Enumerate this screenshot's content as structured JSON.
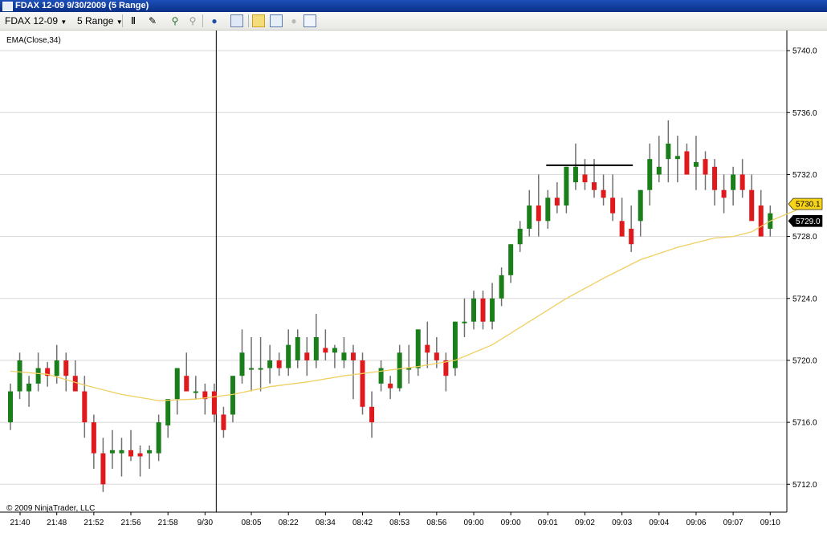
{
  "window": {
    "title": "FDAX 12-09  9/30/2009 (5 Range)"
  },
  "toolbar": {
    "instrument": "FDAX 12-09",
    "period": "5 Range",
    "icons": [
      "bar-type-icon",
      "drawing-pen-icon",
      "zoom-in-icon",
      "zoom-out-icon",
      "globe-icon",
      "properties-icon",
      "strategy-icon",
      "indicator-icon",
      "record-icon",
      "data-box-icon"
    ]
  },
  "chart_data": {
    "type": "candlestick",
    "indicator_label": "EMA(Close,34)",
    "copyright": "© 2009 NinjaTrader, LLC",
    "ylim": [
      5710.2,
      5741.3
    ],
    "yticks": [
      5712.0,
      5716.0,
      5720.0,
      5724.0,
      5728.0,
      5732.0,
      5736.0,
      5740.0
    ],
    "ytick_labels": [
      "5712.0",
      "5716.0",
      "5720.0",
      "5724.0",
      "5728.0",
      "5732.0",
      "5736.0",
      "5740.0"
    ],
    "grid": true,
    "bar_count": 78,
    "xtick_labels": [
      {
        "i": 0,
        "label": "21:40"
      },
      {
        "i": 5,
        "label": "21:48"
      },
      {
        "i": 9,
        "label": "21:52"
      },
      {
        "i": 13,
        "label": "21:56"
      },
      {
        "i": 17,
        "label": "21:58"
      },
      {
        "i": 21,
        "label": "9/30"
      },
      {
        "i": 26,
        "label": "08:05"
      },
      {
        "i": 30,
        "label": "08:22"
      },
      {
        "i": 34,
        "label": "08:34"
      },
      {
        "i": 38,
        "label": "08:42"
      },
      {
        "i": 42,
        "label": "08:53"
      },
      {
        "i": 46,
        "label": "08:56"
      },
      {
        "i": 50,
        "label": "09:00"
      },
      {
        "i": 54,
        "label": "09:00"
      },
      {
        "i": 58,
        "label": "09:01"
      },
      {
        "i": 62,
        "label": "09:02"
      },
      {
        "i": 66,
        "label": "09:03"
      },
      {
        "i": 70,
        "label": "09:04"
      },
      {
        "i": 74,
        "label": "09:06"
      },
      {
        "i": 78,
        "label": "09:07"
      },
      {
        "i": 82,
        "label": "09:10"
      }
    ],
    "session_break_index": 21,
    "candles": [
      [
        0,
        5716.0,
        5718.5,
        5715.5,
        5718.0
      ],
      [
        1,
        5718.0,
        5720.5,
        5717.5,
        5720.0
      ],
      [
        2,
        5718.0,
        5719.0,
        5717.0,
        5718.5
      ],
      [
        3,
        5718.5,
        5720.5,
        5718.0,
        5719.5
      ],
      [
        4,
        5719.5,
        5719.9,
        5718.3,
        5719.0
      ],
      [
        5,
        5719.0,
        5721.0,
        5718.5,
        5720.0
      ],
      [
        6,
        5720.0,
        5720.5,
        5718.0,
        5719.0
      ],
      [
        7,
        5719.0,
        5720.0,
        5718.0,
        5718.0
      ],
      [
        8,
        5718.0,
        5719.0,
        5715.0,
        5716.0
      ],
      [
        9,
        5716.0,
        5716.5,
        5713.0,
        5714.0
      ],
      [
        10,
        5714.0,
        5715.0,
        5711.5,
        5712.0
      ],
      [
        11,
        5714.0,
        5715.5,
        5713.0,
        5714.2
      ],
      [
        12,
        5714.0,
        5715.0,
        5712.5,
        5714.2
      ],
      [
        13,
        5714.2,
        5715.5,
        5713.5,
        5713.8
      ],
      [
        14,
        5714.0,
        5714.5,
        5712.5,
        5713.8
      ],
      [
        15,
        5714.0,
        5714.5,
        5713.0,
        5714.2
      ],
      [
        16,
        5714.0,
        5716.5,
        5713.5,
        5716.0
      ],
      [
        17,
        5715.8,
        5717.0,
        5715.0,
        5717.5
      ],
      [
        18,
        5717.5,
        5719.5,
        5716.5,
        5719.5
      ],
      [
        19,
        5719.0,
        5720.5,
        5718.5,
        5718.0
      ],
      [
        20,
        5718.0,
        5719.0,
        5717.5,
        5718.0
      ],
      [
        21,
        5718.0,
        5718.5,
        5716.5,
        5717.5
      ],
      [
        22,
        5718.0,
        5718.5,
        5716.0,
        5716.5
      ],
      [
        23,
        5716.5,
        5717.0,
        5715.0,
        5715.5
      ],
      [
        24,
        5716.5,
        5719.0,
        5716.0,
        5719.0
      ],
      [
        25,
        5719.0,
        5722.0,
        5718.5,
        5720.5
      ],
      [
        26,
        5719.5,
        5721.5,
        5718.0,
        5719.5
      ],
      [
        27,
        5719.5,
        5721.5,
        5718.0,
        5719.5
      ],
      [
        28,
        5719.5,
        5721.0,
        5718.5,
        5720.0
      ],
      [
        29,
        5720.0,
        5720.5,
        5719.0,
        5719.5
      ],
      [
        30,
        5719.5,
        5722.0,
        5719.0,
        5721.0
      ],
      [
        31,
        5720.0,
        5722.0,
        5719.5,
        5721.5
      ],
      [
        32,
        5720.5,
        5721.5,
        5719.0,
        5720.0
      ],
      [
        33,
        5720.0,
        5723.0,
        5719.5,
        5721.5
      ],
      [
        34,
        5720.8,
        5722.0,
        5720.0,
        5720.5
      ],
      [
        35,
        5720.5,
        5721.0,
        5719.5,
        5720.8
      ],
      [
        36,
        5720.0,
        5721.5,
        5719.5,
        5720.5
      ],
      [
        37,
        5720.5,
        5721.0,
        5717.5,
        5720.0
      ],
      [
        38,
        5720.0,
        5720.5,
        5716.5,
        5717.0
      ],
      [
        39,
        5717.0,
        5718.0,
        5715.0,
        5716.0
      ],
      [
        40,
        5718.5,
        5720.0,
        5718.0,
        5719.5
      ],
      [
        41,
        5718.5,
        5719.0,
        5717.5,
        5718.2
      ],
      [
        42,
        5718.2,
        5721.0,
        5718.0,
        5720.5
      ],
      [
        43,
        5719.5,
        5721.0,
        5718.5,
        5719.5
      ],
      [
        44,
        5719.5,
        5722.0,
        5719.0,
        5722.0
      ],
      [
        45,
        5721.0,
        5722.5,
        5719.5,
        5720.5
      ],
      [
        46,
        5720.5,
        5721.5,
        5719.5,
        5720.0
      ],
      [
        47,
        5720.0,
        5720.5,
        5718.0,
        5719.0
      ],
      [
        48,
        5719.5,
        5722.5,
        5719.0,
        5722.5
      ],
      [
        49,
        5722.5,
        5724.0,
        5721.5,
        5722.5
      ],
      [
        50,
        5722.5,
        5724.5,
        5722.0,
        5724.0
      ],
      [
        51,
        5724.0,
        5724.5,
        5722.0,
        5722.5
      ],
      [
        52,
        5722.5,
        5725.0,
        5722.0,
        5724.0
      ],
      [
        53,
        5724.0,
        5726.0,
        5723.5,
        5725.5
      ],
      [
        54,
        5725.5,
        5727.5,
        5725.0,
        5727.5
      ],
      [
        55,
        5727.5,
        5729.0,
        5727.0,
        5728.5
      ],
      [
        56,
        5728.5,
        5731.0,
        5728.0,
        5730.0
      ],
      [
        57,
        5730.0,
        5732.0,
        5728.0,
        5729.0
      ],
      [
        58,
        5729.0,
        5731.0,
        5728.5,
        5730.5
      ],
      [
        59,
        5730.5,
        5731.5,
        5729.5,
        5730.0
      ],
      [
        60,
        5730.0,
        5732.5,
        5729.5,
        5732.5
      ],
      [
        61,
        5731.5,
        5734.0,
        5731.0,
        5732.5
      ],
      [
        62,
        5732.0,
        5733.0,
        5731.0,
        5731.5
      ],
      [
        63,
        5731.5,
        5733.0,
        5730.5,
        5731.0
      ],
      [
        64,
        5731.0,
        5732.0,
        5730.0,
        5730.5
      ],
      [
        65,
        5730.5,
        5732.0,
        5729.0,
        5729.5
      ],
      [
        66,
        5729.0,
        5730.5,
        5728.0,
        5728.0
      ],
      [
        67,
        5728.5,
        5730.0,
        5727.0,
        5727.5
      ],
      [
        68,
        5729.0,
        5731.0,
        5728.0,
        5731.0
      ],
      [
        69,
        5731.0,
        5734.0,
        5730.0,
        5733.0
      ],
      [
        70,
        5732.0,
        5734.5,
        5731.5,
        5732.5
      ],
      [
        71,
        5733.0,
        5735.5,
        5731.5,
        5734.0
      ],
      [
        72,
        5733.0,
        5734.5,
        5731.5,
        5733.2
      ],
      [
        73,
        5733.5,
        5734.0,
        5732.0,
        5732.0
      ],
      [
        74,
        5732.5,
        5734.5,
        5731.0,
        5732.8
      ],
      [
        75,
        5733.0,
        5733.5,
        5731.0,
        5732.0
      ],
      [
        76,
        5732.5,
        5733.0,
        5730.0,
        5731.0
      ],
      [
        77,
        5731.0,
        5732.0,
        5729.5,
        5730.5
      ],
      [
        78,
        5731.0,
        5732.5,
        5730.0,
        5732.0
      ],
      [
        79,
        5732.0,
        5733.0,
        5730.5,
        5731.0
      ],
      [
        80,
        5731.0,
        5732.0,
        5729.5,
        5729.0
      ],
      [
        81,
        5730.0,
        5731.0,
        5728.5,
        5728.0
      ],
      [
        82,
        5728.5,
        5730.0,
        5728.0,
        5729.5
      ]
    ],
    "ema": [
      [
        0,
        5719.3
      ],
      [
        4,
        5719.1
      ],
      [
        8,
        5718.4
      ],
      [
        12,
        5717.8
      ],
      [
        16,
        5717.4
      ],
      [
        20,
        5717.5
      ],
      [
        24,
        5717.8
      ],
      [
        28,
        5718.3
      ],
      [
        32,
        5718.6
      ],
      [
        36,
        5719.0
      ],
      [
        40,
        5719.3
      ],
      [
        44,
        5719.6
      ],
      [
        48,
        5720.0
      ],
      [
        52,
        5721.0
      ],
      [
        56,
        5722.5
      ],
      [
        60,
        5724.0
      ],
      [
        64,
        5725.3
      ],
      [
        68,
        5726.5
      ],
      [
        72,
        5727.3
      ],
      [
        76,
        5727.9
      ],
      [
        78,
        5728.0
      ],
      [
        80,
        5728.3
      ],
      [
        82,
        5729.0
      ],
      [
        86,
        5730.0
      ]
    ],
    "hline": {
      "value": 5732.6,
      "from_index": 58,
      "to_index": 67
    },
    "price_markers": [
      {
        "label": "5730.1",
        "value": 5730.1,
        "bg": "#f7d417",
        "fg": "#000000"
      },
      {
        "label": "5729.0",
        "value": 5729.0,
        "bg": "#000000",
        "fg": "#ffffff"
      }
    ],
    "colors": {
      "up": "#1a7f1a",
      "down": "#e0191d",
      "wick": "#707070",
      "ema": "#efcf60",
      "grid": "#d8d8d8"
    }
  }
}
